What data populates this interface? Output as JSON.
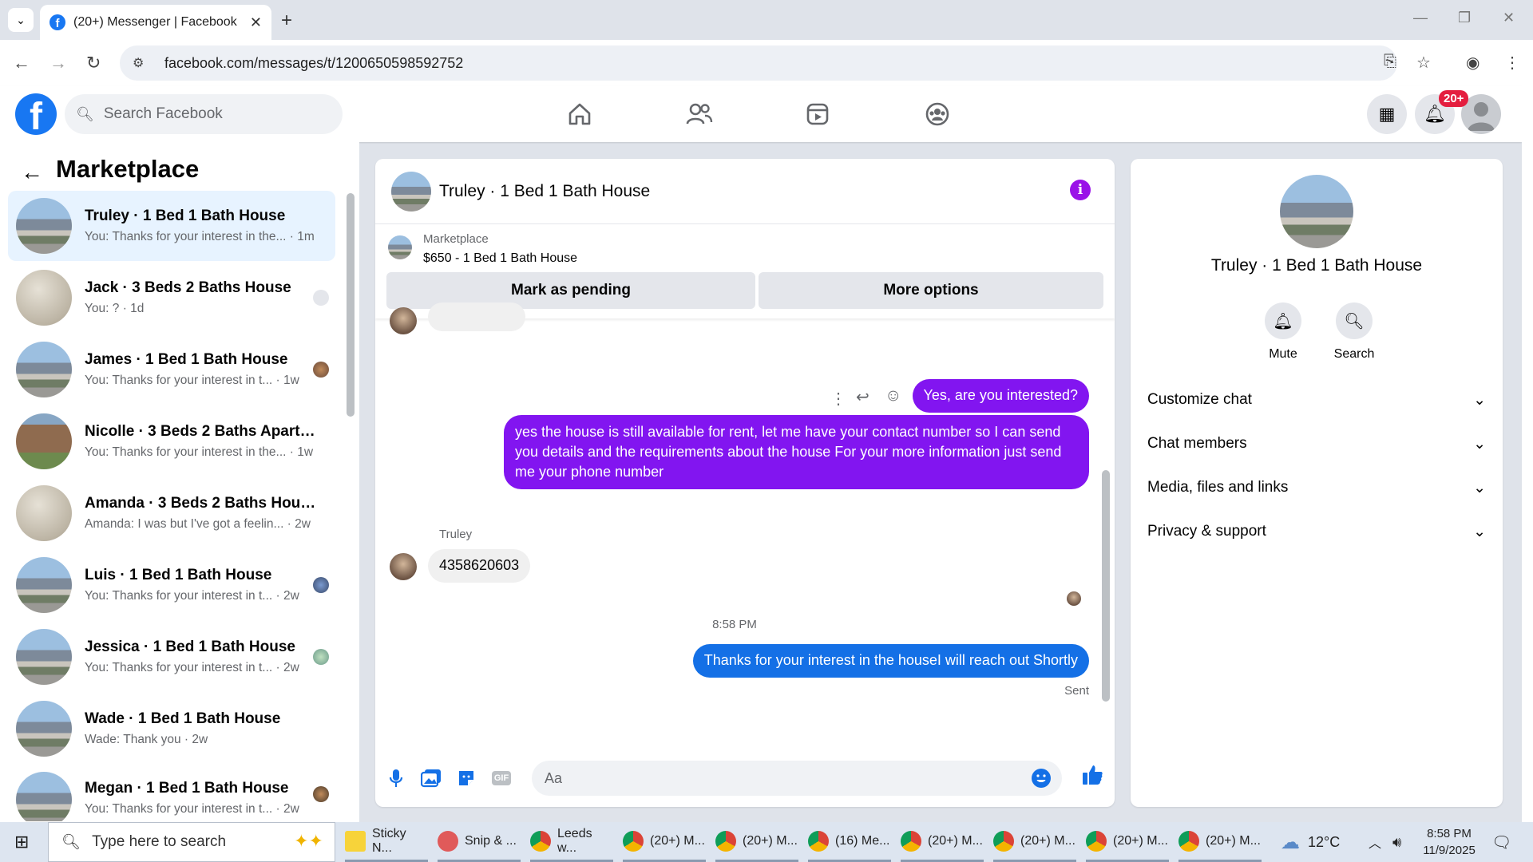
{
  "browser": {
    "tab_title": "(20+) Messenger | Facebook",
    "url": "facebook.com/messages/t/1200650598592752"
  },
  "fb": {
    "search_placeholder": "Search Facebook",
    "notif_badge": "20+"
  },
  "sidebar": {
    "title": "Marketplace",
    "conversations": [
      {
        "name": "Truley · 1 Bed 1 Bath House",
        "preview": "You: Thanks for your interest in the... · 1m",
        "thumb": "house",
        "active": true
      },
      {
        "name": "Jack · 3 Beds 2 Baths House",
        "preview": "You: ? · 1d",
        "thumb": "wall"
      },
      {
        "name": "James · 1 Bed 1 Bath House",
        "preview": "You: Thanks for your interest in t... · 1w",
        "thumb": "house"
      },
      {
        "name": "Nicolle · 3 Beds 2 Baths Apartm...",
        "preview": "You: Thanks for your interest in the... · 1w",
        "thumb": "apt"
      },
      {
        "name": "Amanda · 3 Beds 2 Baths House",
        "preview": "Amanda: I was but I've got a feelin... · 2w",
        "thumb": "wall"
      },
      {
        "name": "Luis · 1 Bed 1 Bath House",
        "preview": "You: Thanks for your interest in t... · 2w",
        "thumb": "house"
      },
      {
        "name": "Jessica · 1 Bed 1 Bath House",
        "preview": "You: Thanks for your interest in t... · 2w",
        "thumb": "house"
      },
      {
        "name": "Wade · 1 Bed 1 Bath House",
        "preview": "Wade: Thank you · 2w",
        "thumb": "house"
      },
      {
        "name": "Megan · 1 Bed 1 Bath House",
        "preview": "You: Thanks for your interest in t... · 2w",
        "thumb": "house"
      }
    ]
  },
  "chat": {
    "title": "Truley · 1 Bed 1 Bath House",
    "marketplace_label": "Marketplace",
    "listing": "$650 - 1 Bed 1 Bath House",
    "mark_pending": "Mark as pending",
    "more_options": "More options",
    "msg_sent_1": "Yes, are you interested?",
    "msg_sent_2": "yes the house is still available for rent, let me have your contact number so I can send you details and the requirements about the house For  your  more  information  just send  me   your  phone  number",
    "sender_name": "Truley",
    "msg_received": "4358620603",
    "timestamp": "8:58 PM",
    "msg_sent_3": "Thanks for your interest in the houseI will reach out Shortly",
    "status": "Sent",
    "composer_placeholder": "Aa"
  },
  "details": {
    "name": "Truley · 1 Bed 1 Bath House",
    "mute": "Mute",
    "search": "Search",
    "rows": [
      "Customize chat",
      "Chat members",
      "Media, files and links",
      "Privacy & support"
    ]
  },
  "taskbar": {
    "search_placeholder": "Type here to search",
    "apps": [
      "Sticky N...",
      "Snip & ...",
      "Leeds w...",
      "(20+) M...",
      "(20+) M...",
      "(16) Me...",
      "(20+) M...",
      "(20+) M...",
      "(20+) M...",
      "(20+) M..."
    ],
    "weather": "12°C",
    "time": "8:58 PM",
    "date": "11/9/2025"
  }
}
